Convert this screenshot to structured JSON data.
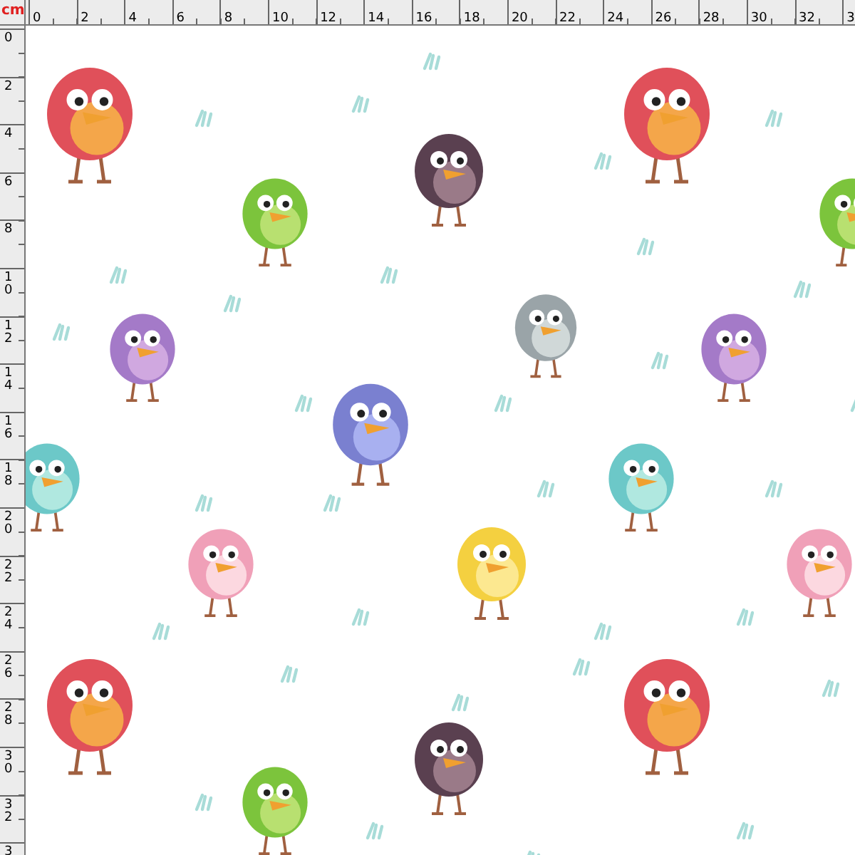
{
  "ruler_top": {
    "unit": "cm",
    "labels": [
      "0",
      "2",
      "4",
      "6",
      "8",
      "10",
      "12",
      "14",
      "16",
      "18",
      "20",
      "22",
      "24",
      "26",
      "28",
      "30",
      "32",
      "3"
    ]
  },
  "ruler_left": {
    "labels": [
      "0",
      "2",
      "4",
      "6",
      "8",
      "10",
      "12",
      "14",
      "16",
      "18",
      "20",
      "22",
      "24",
      "26",
      "28",
      "30",
      "32",
      "3"
    ]
  }
}
